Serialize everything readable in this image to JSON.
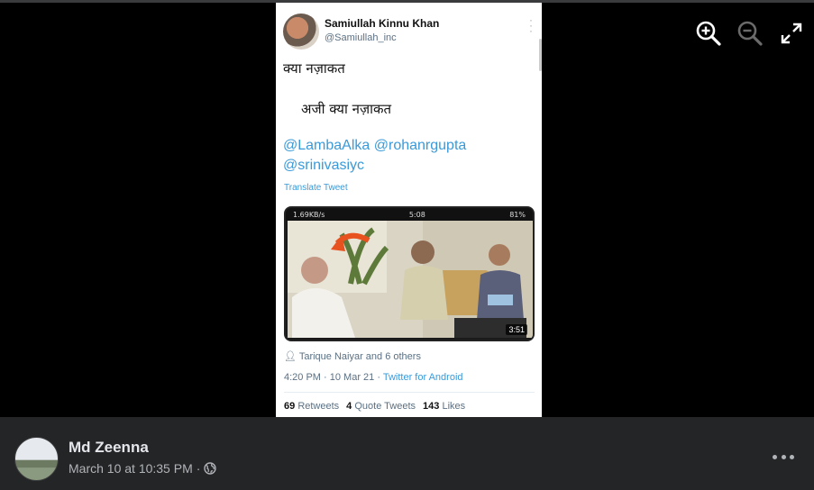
{
  "viewer": {
    "zoom_in_icon": "magnifier-plus-icon",
    "zoom_out_icon": "magnifier-minus-icon",
    "fullscreen_icon": "expand-arrows-icon"
  },
  "tweet": {
    "author_name": "Samiullah Kinnu Khan",
    "author_handle": "@Samiullah_inc",
    "line1": "क्या नज़ाकत",
    "line2": "अजी क्या नज़ाकत",
    "mentions": [
      "@LambaAlka",
      "@rohanrgupta",
      "@srinivasiyc"
    ],
    "translate_label": "Translate Tweet",
    "media": {
      "status_left": "1.69KB/s",
      "status_time": "5:08",
      "status_battery": "81%",
      "duration": "3:51"
    },
    "retweeted_by": "Tarique Naiyar and 6 others",
    "timestamp": "4:20 PM · 10 Mar 21 · ",
    "client_link": "Twitter for Android",
    "stats": {
      "retweets_count": "69",
      "retweets_label": "Retweets",
      "quotes_count": "4",
      "quotes_label": "Quote Tweets",
      "likes_count": "143",
      "likes_label": "Likes"
    }
  },
  "post": {
    "author": "Md Zeenna",
    "date": "March 10 at 10:35 PM",
    "separator": "·",
    "privacy_icon": "globe-icon",
    "more_icon": "ellipsis-icon"
  },
  "colors": {
    "link": "#3a9ad9",
    "footer_bg": "#242526",
    "footer_text": "#e4e6eb"
  }
}
